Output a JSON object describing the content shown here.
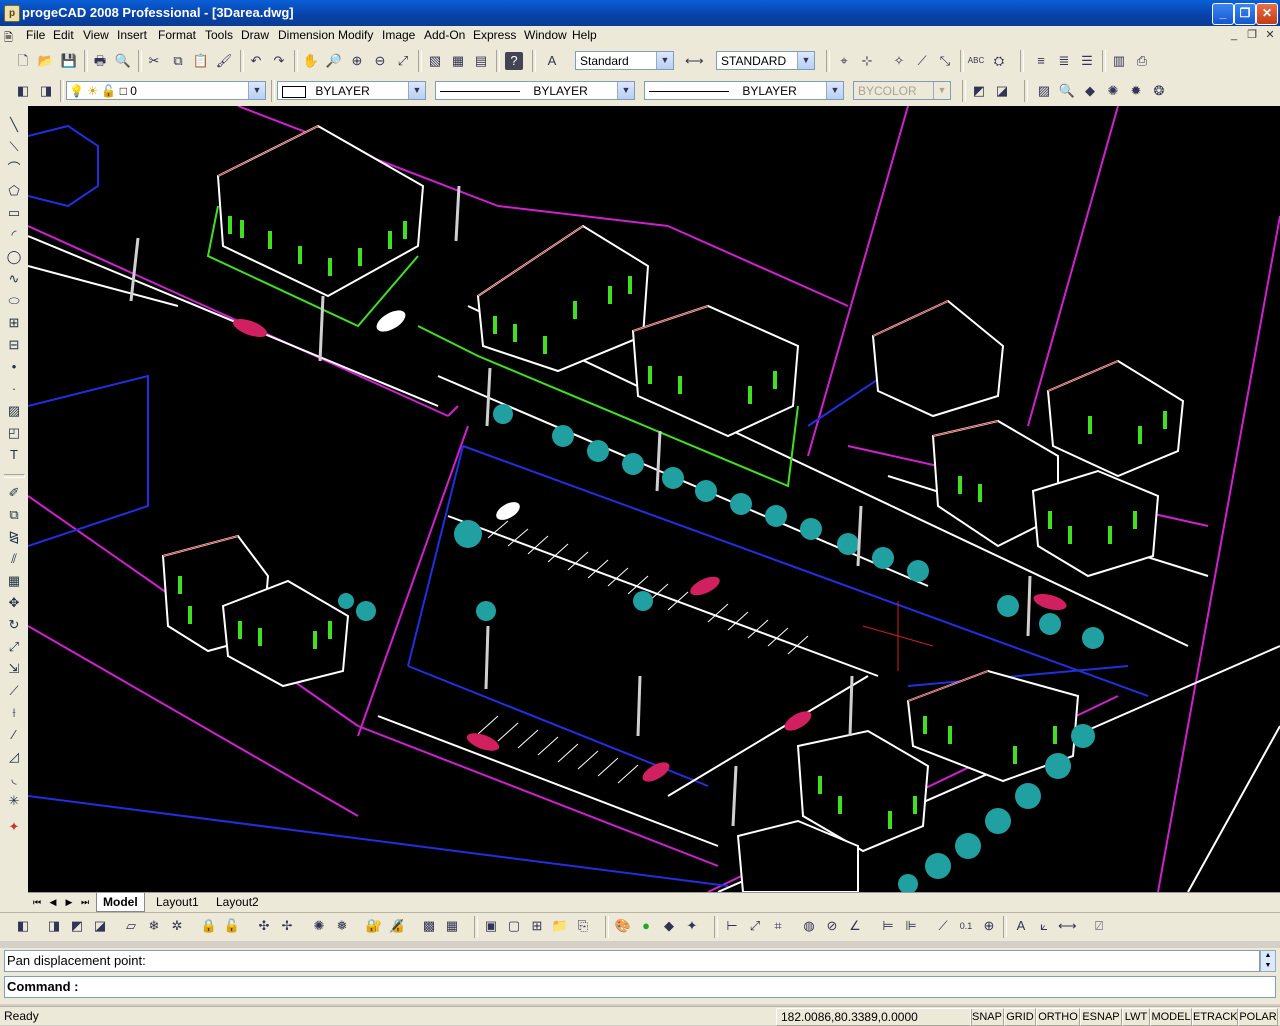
{
  "window": {
    "title": "progeCAD 2008 Professional - [3Darea.dwg]",
    "app_icon": "progecad-icon",
    "controls": [
      "minimize",
      "restore",
      "close"
    ]
  },
  "menubar": {
    "items": [
      "File",
      "Edit",
      "View",
      "Insert",
      "Format",
      "Tools",
      "Draw",
      "Dimension",
      "Modify",
      "Image",
      "Add-On",
      "Express",
      "Window",
      "Help"
    ]
  },
  "toolbar_standard": {
    "text_style": "Standard",
    "dim_style": "STANDARD"
  },
  "toolbar_properties": {
    "layer": "0",
    "color": "BYLAYER",
    "linetype": "BYLAYER",
    "lineweight": "BYLAYER",
    "plotstyle": "BYCOLOR"
  },
  "tabs": {
    "items": [
      "Model",
      "Layout1",
      "Layout2"
    ],
    "active": "Model"
  },
  "command": {
    "history": "Pan displacement point:",
    "prompt": "Command :"
  },
  "status": {
    "text": "Ready",
    "coords": "182.0086,80.3389,0.0000",
    "toggles": [
      "SNAP",
      "GRID",
      "ORTHO",
      "ESNAP",
      "LWT",
      "MODEL",
      "ETRACK",
      "POLAR"
    ]
  },
  "colors": {
    "titlebar": "#0842a6",
    "viewport_bg": "#000000",
    "cad_magenta": "#d020d0",
    "cad_blue": "#2030e0",
    "cad_green": "#40e020",
    "cad_white": "#ffffff",
    "cad_cyan": "#20a0a0"
  }
}
